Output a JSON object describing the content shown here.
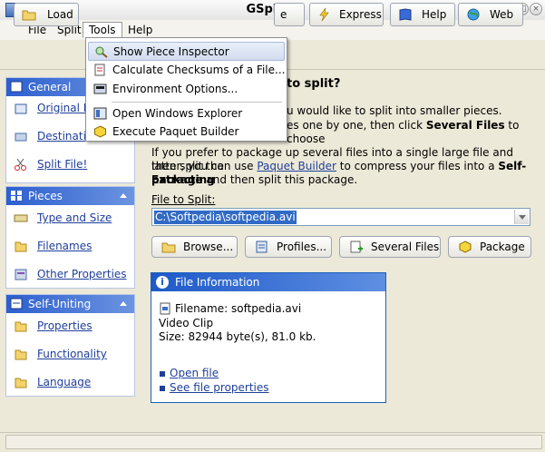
{
  "window": {
    "title": "GSplit 3"
  },
  "menubar": [
    "File",
    "Split",
    "Tools",
    "Help"
  ],
  "toolbar": {
    "load": "Load",
    "partial": "e",
    "express": "Express",
    "help": "Help",
    "web": "Web"
  },
  "tools_menu": {
    "items": [
      {
        "label": "Show Piece Inspector",
        "icon": "magnifier-piece-icon"
      },
      {
        "label": "Calculate Checksums of a File...",
        "icon": "checksum-icon"
      },
      {
        "label": "Environment Options...",
        "icon": "options-icon"
      },
      {
        "label": "Open Windows Explorer",
        "icon": "explorer-icon"
      },
      {
        "label": "Execute Paquet Builder",
        "icon": "package-icon"
      }
    ]
  },
  "sidebar": {
    "general": {
      "title": "General",
      "items": [
        "Original F",
        "Destinatio",
        "Split File!"
      ]
    },
    "pieces": {
      "title": "Pieces",
      "items": [
        "Type and Size",
        "Filenames",
        "Other Properties"
      ]
    },
    "self_uniting": {
      "title": "Self-Uniting",
      "items": [
        "Properties",
        "Functionality",
        "Language"
      ]
    }
  },
  "main": {
    "heading": "to split?",
    "para1_line1": "u would like to split into smaller pieces.",
    "para1_line2_pre": "es one by one, then click ",
    "para1_line2_bold": "Several Files",
    "para1_line2_post": " to choose",
    "para2_line1": "If you prefer to package up several files into a single large file and then split the",
    "para2_line2_pre": "latter, you can use ",
    "para2_link": "Paquet Builder",
    "para2_line2_mid": " to compress your files into a ",
    "para2_line2_bold": "Self-Extracting",
    "para2_line3_bold": "package",
    "para2_line3_post": " and then split this package.",
    "file_label": "File to Split:",
    "file_value": "C:\\Softpedia\\softpedia.avi",
    "buttons": {
      "browse": "Browse...",
      "profiles": "Profiles...",
      "several": "Several Files",
      "package": "Package"
    }
  },
  "file_info": {
    "title": "File Information",
    "filename": "Filename: softpedia.avi",
    "type": "Video Clip",
    "size": "Size: 82944 byte(s), 81.0 kb.",
    "open_file": "Open file",
    "see_props": "See file properties"
  },
  "colors": {
    "panel_header": "#2d5fcf",
    "link": "#1f3f9a",
    "selection": "#316ac5"
  }
}
